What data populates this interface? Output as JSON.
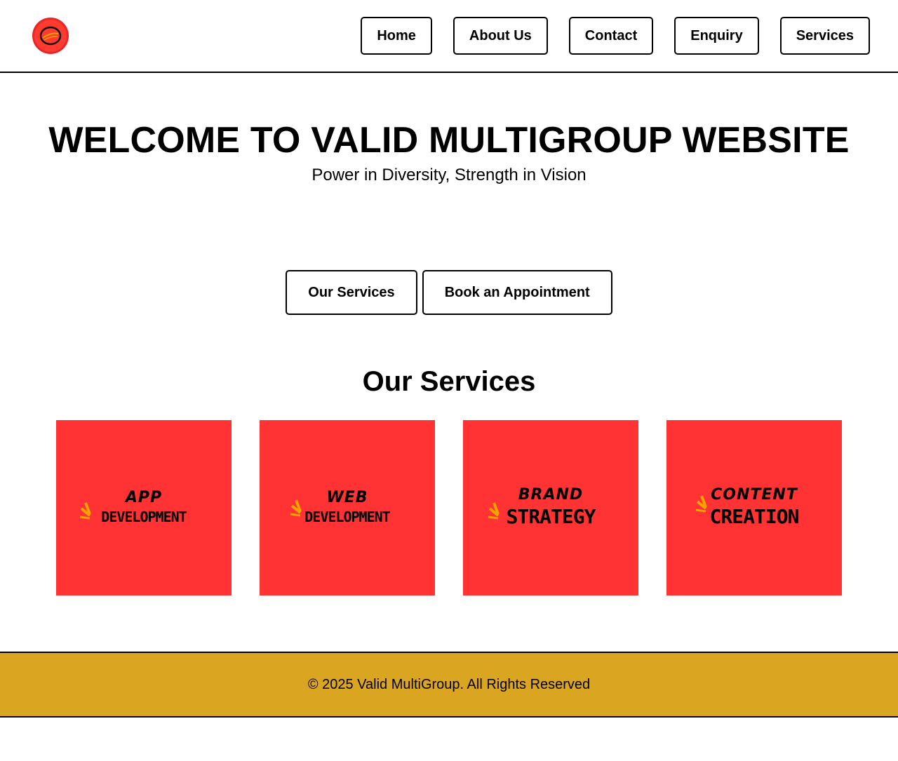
{
  "header": {
    "logo_icon": "valid-multigroup-logo",
    "nav": [
      {
        "label": "Home"
      },
      {
        "label": "About Us"
      },
      {
        "label": "Contact"
      },
      {
        "label": "Enquiry"
      },
      {
        "label": "Services"
      }
    ]
  },
  "hero": {
    "title": "WELCOME TO VALID MULTIGROUP WEBSITE",
    "tagline": "Power in Diversity, Strength in Vision",
    "buttons": {
      "services": "Our Services",
      "appointment": "Book an Appointment"
    }
  },
  "services": {
    "title": "Our Services",
    "cards": [
      {
        "line1": "APP",
        "line2": "DEVELOPMENT"
      },
      {
        "line1": "WEB",
        "line2": "DEVELOPMENT"
      },
      {
        "line1": "BRAND",
        "line2": "STRATEGY"
      },
      {
        "line1": "CONTENT",
        "line2": "CREATION"
      }
    ]
  },
  "footer": {
    "text": "© 2025 Valid MultiGroup. All Rights Reserved"
  },
  "colors": {
    "card_red": "#ff3333",
    "footer_gold": "#daa520",
    "burst_orange": "#f5a300"
  }
}
